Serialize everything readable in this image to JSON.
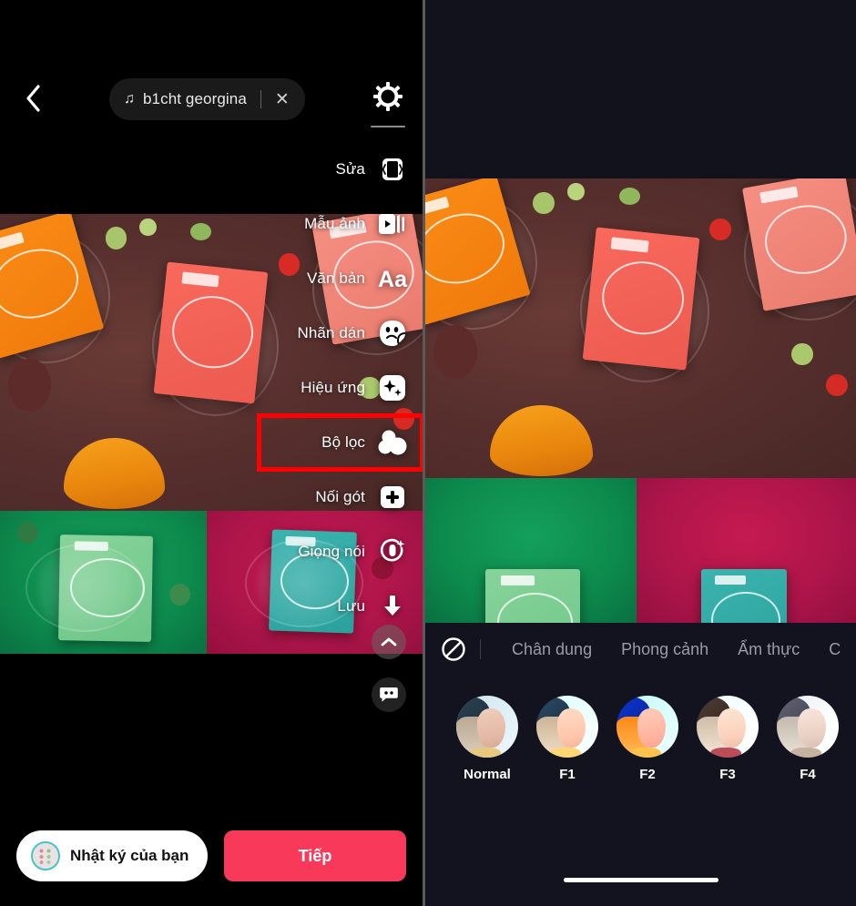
{
  "left": {
    "back_icon": "chevron-left-icon",
    "music": {
      "note_icon": "music-note-icon",
      "title": "b1cht georgina",
      "close_icon": "close-icon"
    },
    "gear_icon": "gear-icon",
    "tools": [
      {
        "label": "Sửa",
        "icon": "trim-edit-icon",
        "highlighted": false
      },
      {
        "label": "Mẫu ảnh",
        "icon": "photo-template-icon",
        "highlighted": false
      },
      {
        "label": "Văn bản",
        "icon": "text-aa-icon",
        "highlighted": false
      },
      {
        "label": "Nhãn dán",
        "icon": "sticker-icon",
        "highlighted": false
      },
      {
        "label": "Hiệu ứng",
        "icon": "effects-sparkle-icon",
        "highlighted": false
      },
      {
        "label": "Bộ lọc",
        "icon": "filters-circles-icon",
        "highlighted": true
      },
      {
        "label": "Nối gót",
        "icon": "plus-add-icon",
        "highlighted": false
      },
      {
        "label": "Giọng nói",
        "icon": "voice-mic-icon",
        "highlighted": false
      },
      {
        "label": "Lưu",
        "icon": "download-save-icon",
        "highlighted": false
      }
    ],
    "collapse_icon": "chevron-up-icon",
    "comment_icon": "comment-bubble-icon",
    "bottom": {
      "diary_label": "Nhật ký của bạn",
      "diary_avatar": "avatar",
      "next_label": "Tiếp"
    }
  },
  "right": {
    "no_filter_icon": "no-filter-prohibition-icon",
    "tabs": [
      {
        "label": "Chân dung",
        "active": false
      },
      {
        "label": "Phong cảnh",
        "active": false
      },
      {
        "label": "Ẩm thực",
        "active": false
      },
      {
        "label": "C",
        "active": false
      }
    ],
    "filters": [
      {
        "name": "Normal"
      },
      {
        "name": "F1"
      },
      {
        "name": "F2"
      },
      {
        "name": "F3"
      },
      {
        "name": "F4"
      },
      {
        "name": ""
      }
    ],
    "home_indicator": "home-indicator"
  },
  "colors": {
    "accent_pink": "#f9395a",
    "highlight_red": "#ff0000",
    "sheet_bg": "#13131f",
    "avatar_ring": "#49c2c6"
  }
}
